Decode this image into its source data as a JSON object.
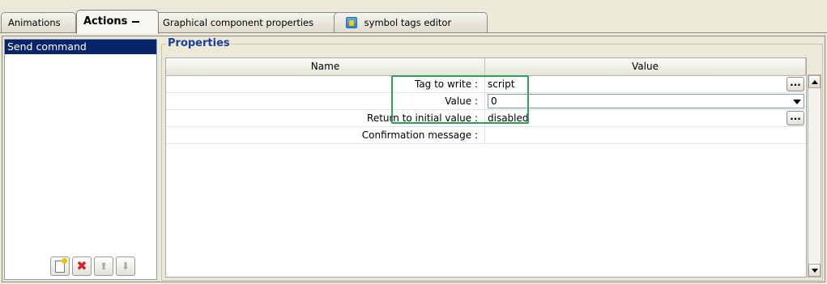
{
  "tabs": [
    {
      "label": "Animations",
      "active": false
    },
    {
      "label": "Actions",
      "active": true
    },
    {
      "label": "Graphical component properties",
      "active": false
    },
    {
      "label": "symbol tags editor",
      "active": false,
      "icon": "symbol-tags-icon"
    }
  ],
  "actions_list": {
    "items": [
      "Send command"
    ],
    "selected": "Send command",
    "buttons": [
      "new-action-icon",
      "delete-icon",
      "move-up-icon",
      "move-down-icon"
    ]
  },
  "properties": {
    "title": "Properties",
    "columns": {
      "name": "Name",
      "value": "Value"
    },
    "rows": [
      {
        "name": "Tag to write :",
        "value": "script",
        "editor": "ellipsis",
        "editor_label": "..."
      },
      {
        "name": "Value :",
        "value": "0",
        "editor": "combo"
      },
      {
        "name": "Return to initial value :",
        "value": "disabled",
        "editor": "ellipsis",
        "editor_label": "..."
      },
      {
        "name": "Confirmation message :",
        "value": "",
        "editor": "none"
      }
    ]
  },
  "colors": {
    "selection": "#0a246a",
    "group_title": "#1a3e9e",
    "highlight": "#2f9d5b"
  }
}
